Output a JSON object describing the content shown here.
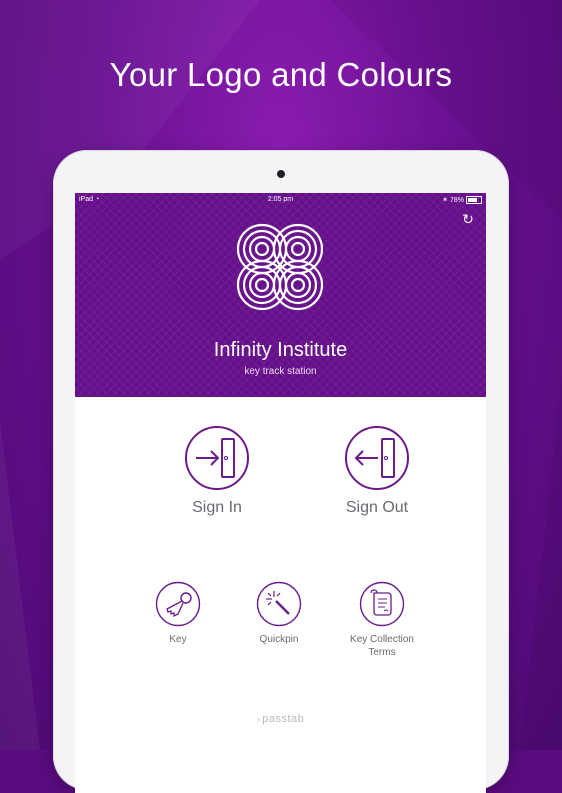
{
  "headline": "Your Logo and Colours",
  "status_bar": {
    "device": "iPad",
    "time": "2:05 pm",
    "battery": "78%"
  },
  "header": {
    "org_name": "Infinity Institute",
    "subtitle": "key track station",
    "refresh_icon": "refresh-icon"
  },
  "actions": {
    "sign_in": "Sign In",
    "sign_out": "Sign Out",
    "key": "Key",
    "quickpin": "Quickpin",
    "terms_line1": "Key Collection",
    "terms_line2": "Terms"
  },
  "footer": {
    "brand": "passtab"
  },
  "colors": {
    "brand_purple": "#650f8a",
    "icon_purple": "#6a1b8a",
    "background_purple": "#5a0c80"
  }
}
